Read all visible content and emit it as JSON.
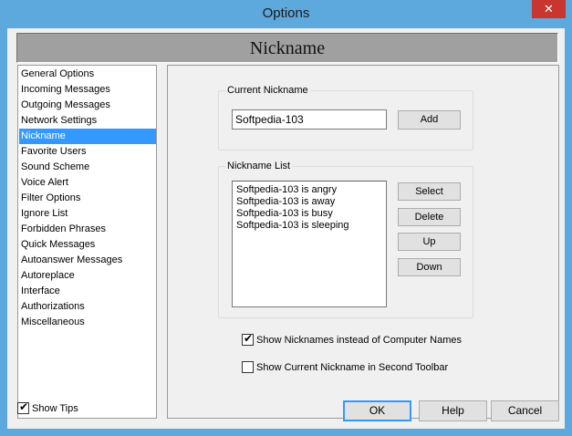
{
  "window": {
    "title": "Options",
    "close_glyph": "✕"
  },
  "header": {
    "title": "Nickname"
  },
  "sidebar": {
    "items": [
      {
        "label": "General Options",
        "selected": false
      },
      {
        "label": "Incoming Messages",
        "selected": false
      },
      {
        "label": "Outgoing Messages",
        "selected": false
      },
      {
        "label": "Network Settings",
        "selected": false
      },
      {
        "label": "Nickname",
        "selected": true
      },
      {
        "label": "Favorite Users",
        "selected": false
      },
      {
        "label": "Sound Scheme",
        "selected": false
      },
      {
        "label": "Voice Alert",
        "selected": false
      },
      {
        "label": "Filter Options",
        "selected": false
      },
      {
        "label": "Ignore List",
        "selected": false
      },
      {
        "label": "Forbidden Phrases",
        "selected": false
      },
      {
        "label": "Quick Messages",
        "selected": false
      },
      {
        "label": "Autoanswer Messages",
        "selected": false
      },
      {
        "label": "Autoreplace",
        "selected": false
      },
      {
        "label": "Interface",
        "selected": false
      },
      {
        "label": "Authorizations",
        "selected": false
      },
      {
        "label": "Miscellaneous",
        "selected": false
      }
    ]
  },
  "current_nickname": {
    "group_label": "Current Nickname",
    "value": "Softpedia-103",
    "add_label": "Add"
  },
  "nickname_list": {
    "group_label": "Nickname List",
    "items": [
      "Softpedia-103 is angry",
      "Softpedia-103 is away",
      "Softpedia-103 is busy",
      "Softpedia-103 is sleeping"
    ],
    "select_label": "Select",
    "delete_label": "Delete",
    "up_label": "Up",
    "down_label": "Down"
  },
  "options": {
    "show_nicknames_label": "Show Nicknames instead of Computer Names",
    "show_nicknames_checked": true,
    "show_current_label": "Show Current Nickname in Second Toolbar",
    "show_current_checked": false
  },
  "footer": {
    "show_tips_label": "Show Tips",
    "show_tips_checked": true,
    "ok_label": "OK",
    "help_label": "Help",
    "cancel_label": "Cancel"
  },
  "check_glyph": "✔"
}
